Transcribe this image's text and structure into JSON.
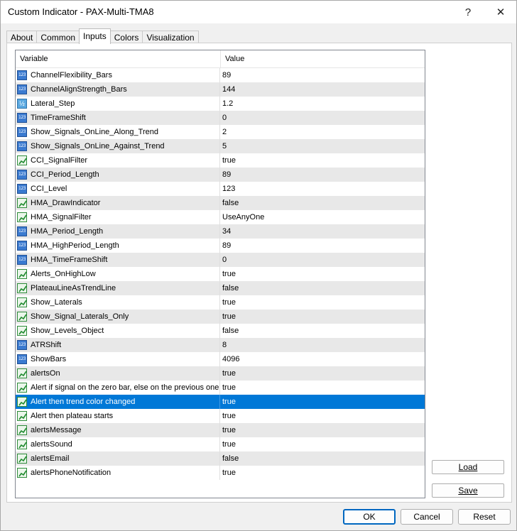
{
  "window": {
    "title": "Custom Indicator - PAX-Multi-TMA8",
    "help_label": "?",
    "close_label": "✕"
  },
  "tabs": [
    {
      "label": "About",
      "active": false
    },
    {
      "label": "Common",
      "active": false
    },
    {
      "label": "Inputs",
      "active": true
    },
    {
      "label": "Colors",
      "active": false
    },
    {
      "label": "Visualization",
      "active": false
    }
  ],
  "table": {
    "headers": {
      "variable": "Variable",
      "value": "Value"
    },
    "rows": [
      {
        "icon": "int-icon",
        "name": "ChannelFlexibility_Bars",
        "value": "89"
      },
      {
        "icon": "int-icon",
        "name": "ChannelAlignStrength_Bars",
        "value": "144"
      },
      {
        "icon": "double-icon",
        "name": "Lateral_Step",
        "value": "1.2"
      },
      {
        "icon": "int-icon",
        "name": "TimeFrameShift",
        "value": "0"
      },
      {
        "icon": "int-icon",
        "name": "Show_Signals_OnLine_Along_Trend",
        "value": "2"
      },
      {
        "icon": "int-icon",
        "name": "Show_Signals_OnLine_Against_Trend",
        "value": "5"
      },
      {
        "icon": "bool-icon",
        "name": "CCI_SignalFilter",
        "value": "true"
      },
      {
        "icon": "int-icon",
        "name": "CCI_Period_Length",
        "value": "89"
      },
      {
        "icon": "int-icon",
        "name": "CCI_Level",
        "value": "123"
      },
      {
        "icon": "bool-icon",
        "name": "HMA_DrawIndicator",
        "value": "false"
      },
      {
        "icon": "enum-icon",
        "name": "HMA_SignalFilter",
        "value": "UseAnyOne"
      },
      {
        "icon": "int-icon",
        "name": "HMA_Period_Length",
        "value": "34"
      },
      {
        "icon": "int-icon",
        "name": "HMA_HighPeriod_Length",
        "value": "89"
      },
      {
        "icon": "int-icon",
        "name": "HMA_TimeFrameShift",
        "value": "0"
      },
      {
        "icon": "bool-icon",
        "name": "Alerts_OnHighLow",
        "value": "true"
      },
      {
        "icon": "bool-icon",
        "name": "PlateauLineAsTrendLine",
        "value": "false"
      },
      {
        "icon": "bool-icon",
        "name": "Show_Laterals",
        "value": "true"
      },
      {
        "icon": "bool-icon",
        "name": "Show_Signal_Laterals_Only",
        "value": "true"
      },
      {
        "icon": "bool-icon",
        "name": "Show_Levels_Object",
        "value": "false"
      },
      {
        "icon": "int-icon",
        "name": "ATRShift",
        "value": "8"
      },
      {
        "icon": "int-icon",
        "name": "ShowBars",
        "value": "4096"
      },
      {
        "icon": "bool-icon",
        "name": "alertsOn",
        "value": "true"
      },
      {
        "icon": "bool-icon",
        "name": "Alert if signal on the zero bar, else on the previous one",
        "value": "true"
      },
      {
        "icon": "bool-icon",
        "name": "Alert then trend color changed",
        "value": "true",
        "selected": true
      },
      {
        "icon": "bool-icon",
        "name": "Alert then plateau starts",
        "value": "true"
      },
      {
        "icon": "bool-icon",
        "name": "alertsMessage",
        "value": "true"
      },
      {
        "icon": "bool-icon",
        "name": "alertsSound",
        "value": "true"
      },
      {
        "icon": "bool-icon",
        "name": "alertsEmail",
        "value": "false"
      },
      {
        "icon": "bool-icon",
        "name": "alertsPhoneNotification",
        "value": "true"
      }
    ]
  },
  "side_buttons": {
    "load_label": "Load",
    "save_label": "Save"
  },
  "footer": {
    "ok_label": "OK",
    "cancel_label": "Cancel",
    "reset_label": "Reset"
  },
  "colors": {
    "selection": "#0078d7",
    "alt_row": "#e8e8e8",
    "primary_border": "#0067c0"
  }
}
